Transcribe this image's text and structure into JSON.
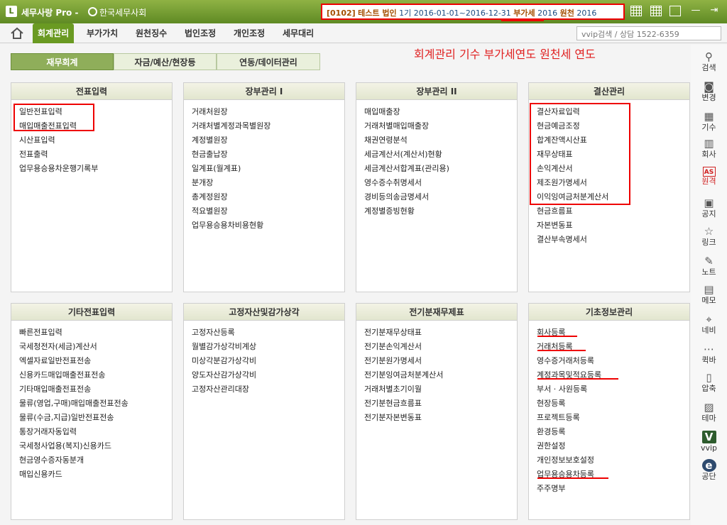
{
  "titlebar": {
    "logo": "L",
    "app_title": "세무사랑 Pro -",
    "org_name": "한국세무사회",
    "code": "[0102]",
    "company": "테스트 법인",
    "period": "1기 2016-01-01~2016-12-31",
    "vat_label": "부가세",
    "vat_year": "2016",
    "wht_label": "원천",
    "wht_year": "2016"
  },
  "menu": {
    "items": [
      "회계관리",
      "부가가치",
      "원천징수",
      "법인조정",
      "개인조정",
      "세무대리"
    ],
    "search_placeholder": "vvip검색 / 상담 1522-6359"
  },
  "subtabs": [
    "재무회계",
    "자금/예산/현장등",
    "연동/데이터관리"
  ],
  "annotation": "회계관리 기수   부가세연도 원천세 연도",
  "panels": [
    {
      "title": "전표입력",
      "items": [
        "일반전표입력",
        "매입매출전표입력",
        "시산표입력",
        "전표출력",
        "업무용승용차운행기록부"
      ]
    },
    {
      "title": "장부관리 I",
      "items": [
        "거래처원장",
        "거래처별계정과목별원장",
        "계정별원장",
        "현금출납장",
        "일계표(월계표)",
        "분개장",
        "총계정원장",
        "적요별원장",
        "업무용승용차비용현황"
      ]
    },
    {
      "title": "장부관리 II",
      "items": [
        "매입매출장",
        "거래처별매입매출장",
        "채권연령분석",
        "세금계산서(계산서)현황",
        "세금계산서합계표(관리용)",
        "영수증수취명세서",
        "경비등의송금명세서",
        "계정별증빙현황"
      ]
    },
    {
      "title": "결산관리",
      "items": [
        "결산자료입력",
        "현금예금조정",
        "합계잔액시산표",
        "재무상태표",
        "손익계산서",
        "제조원가명세서",
        "이익잉여금처분계산서",
        "현금흐름표",
        "자본변동표",
        "결산부속명세서"
      ]
    },
    {
      "title": "기타전표입력",
      "items": [
        "빠른전표입력",
        "국세청전자(세금)계산서",
        "엑셀자료일반전표전송",
        "신용카드매입매출전표전송",
        "기타매입매출전표전송",
        "물류(영업,구매)매입매출전표전송",
        "물류(수금,지급)일반전표전송",
        "통장거래자동입력",
        "국세청사업용(복지)신용카드",
        "현금영수증자동분개",
        "매입신용카드"
      ]
    },
    {
      "title": "고정자산및감가상각",
      "items": [
        "고정자산등록",
        "월별감가상각비계상",
        "미상각분감가상각비",
        "양도자산감가상각비",
        "고정자산관리대장"
      ]
    },
    {
      "title": "전기분재무제표",
      "items": [
        "전기분재무상태표",
        "전기분손익계산서",
        "전기분원가명세서",
        "전기분잉여금처분계산서",
        "거래처별초기이월",
        "전기분현금흐름표",
        "전기분자본변동표"
      ]
    },
    {
      "title": "기초정보관리",
      "items": [
        "회사등록",
        "거래처등록",
        "영수증거래처등록",
        "계정과목및적요등록",
        "부서 · 사원등록",
        "현장등록",
        "프로젝트등록",
        "환경등록",
        "권한설정",
        "개인정보보호설정",
        "업무용승용차등록",
        "주주명부"
      ]
    }
  ],
  "sidebar": [
    {
      "label": "검색",
      "icon": "search-icon",
      "glyph": "⚲"
    },
    {
      "label": "변경",
      "icon": "user-change-icon",
      "glyph": "◙"
    },
    {
      "label": "기수",
      "icon": "calendar-icon",
      "glyph": "▦"
    },
    {
      "label": "회사",
      "icon": "building-icon",
      "glyph": "▥"
    },
    {
      "label": "원격",
      "icon": "remote-support-icon",
      "glyph": "AS"
    },
    {
      "label": "공지",
      "icon": "notice-icon",
      "glyph": "▣"
    },
    {
      "label": "링크",
      "icon": "star-icon",
      "glyph": "☆"
    },
    {
      "label": "노트",
      "icon": "note-icon",
      "glyph": "✎"
    },
    {
      "label": "메모",
      "icon": "memo-icon",
      "glyph": "▤"
    },
    {
      "label": "네비",
      "icon": "navigation-icon",
      "glyph": "⌖"
    },
    {
      "label": "퀵바",
      "icon": "quickbar-icon",
      "glyph": "⋯"
    },
    {
      "label": "압축",
      "icon": "compress-icon",
      "glyph": "▯"
    },
    {
      "label": "테마",
      "icon": "theme-icon",
      "glyph": "▨"
    },
    {
      "label": "vvip",
      "icon": "vvip-icon",
      "glyph": "V"
    },
    {
      "label": "공단",
      "icon": "corporation-icon",
      "glyph": "e"
    }
  ]
}
